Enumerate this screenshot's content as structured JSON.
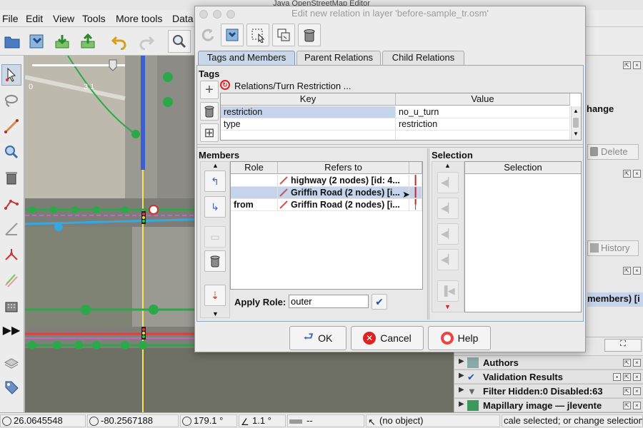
{
  "app": {
    "title": "Java OpenStreetMap Editor",
    "menus": [
      "File",
      "Edit",
      "View",
      "Tools",
      "More tools",
      "Data"
    ]
  },
  "map": {
    "scale_left": "0",
    "scale_right": "3.1"
  },
  "right_panel": {
    "fragment_change": "hange",
    "delete_label": "Delete",
    "history_label": "History",
    "members_fragment": "members) [i",
    "authors": "Authors",
    "validation": "Validation Results",
    "filter": "Filter Hidden:0 Disabled:63",
    "mapillary": "Mapillary image — jlevente"
  },
  "status": {
    "lat": "26.0645548",
    "lon": "-80.2567188",
    "heading": "179.1 °",
    "angle": "1.1 °",
    "distance": "--",
    "object": "(no object)",
    "hint": "cale selected; or change selection"
  },
  "dialog": {
    "title": "Edit new relation in layer 'before-sample_tr.osm'",
    "tabs": [
      "Tags and Members",
      "Parent Relations",
      "Child Relations"
    ],
    "tags": {
      "section": "Tags",
      "preset": "Relations/Turn Restriction ...",
      "col_key": "Key",
      "col_value": "Value",
      "rows": [
        {
          "key": "restriction",
          "value": "no_u_turn"
        },
        {
          "key": "type",
          "value": "restriction"
        }
      ]
    },
    "members": {
      "section": "Members",
      "col_role": "Role",
      "col_refers": "Refers to",
      "rows": [
        {
          "role": "",
          "refers": "highway (2 nodes) [id: 4..."
        },
        {
          "role": "",
          "refers": "Griffin Road (2 nodes) [i..."
        },
        {
          "role": "from",
          "refers": "Griffin Road (2 nodes) [i..."
        }
      ],
      "apply_role_label": "Apply Role:",
      "apply_role_value": "outer"
    },
    "selection": {
      "section": "Selection",
      "col": "Selection"
    },
    "buttons": {
      "ok": "OK",
      "cancel": "Cancel",
      "help": "Help"
    }
  },
  "colors": {
    "accent_blue": "#3b5fd0",
    "map_green": "#2aa84a",
    "selected_row": "#c5d4ea",
    "tab_active": "#c9d7e8"
  }
}
